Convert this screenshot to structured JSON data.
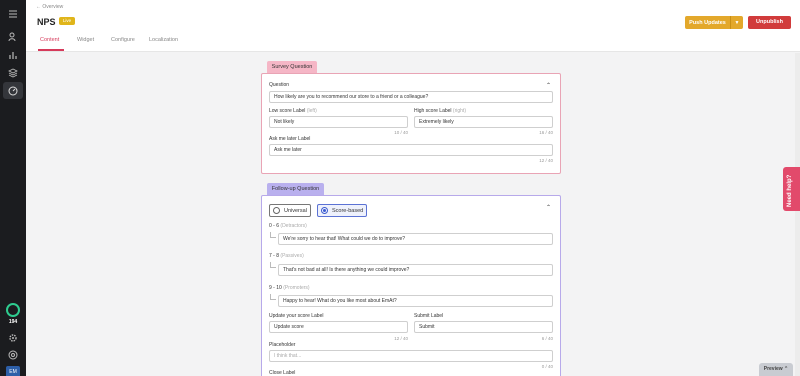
{
  "header": {
    "back_label": "Overview",
    "title": "NPS",
    "badge": "Live",
    "tabs": [
      "Content",
      "Widget",
      "Configure",
      "Localization"
    ],
    "push_label": "Push Updates",
    "unpublish_label": "Unpublish"
  },
  "sidebar": {
    "icons": [
      "users-icon",
      "bar-chart-icon",
      "layers-icon",
      "gauge-icon"
    ],
    "progress_count": "194"
  },
  "survey": {
    "tag": "Survey Question",
    "question_label": "Question",
    "question_value": "How likely are you to recommend our store to a friend or a colleague?",
    "low_label": "Low score Label",
    "low_hint": "(left)",
    "low_value": "Not likely",
    "low_counter": "10 / 40",
    "high_label": "High score Label",
    "high_hint": "(right)",
    "high_value": "Extremely likely",
    "high_counter": "16 / 40",
    "later_label": "Ask me later Label",
    "later_value": "Ask me later",
    "later_counter": "12 / 40"
  },
  "followup": {
    "tag": "Follow-up Question",
    "universal_label": "Universal",
    "score_based_label": "Score-based",
    "selected": "Score-based",
    "detractors_range": "0 - 6",
    "detractors_hint": "(Detractors)",
    "detractors_value": "We're sorry to hear that! What could we do to improve?",
    "passives_range": "7 - 8",
    "passives_hint": "(Passives)",
    "passives_value": "That's not bad at all! Is there anything we could improve?",
    "promoters_range": "9 - 10",
    "promoters_hint": "(Promoters)",
    "promoters_value": "Happy to hear! What do you like most about EmAt?",
    "update_label": "Update your score Label",
    "update_value": "Update score",
    "update_counter": "12 / 40",
    "submit_label": "Submit Label",
    "submit_value": "Submit",
    "submit_counter": "6 / 40",
    "placeholder_label": "Placeholder",
    "placeholder_value": "I think that...",
    "placeholder_counter": "0 / 40",
    "close_label": "Close Label"
  },
  "help_label": "Need help?",
  "preview_label": "Preview",
  "avatar_initials": "EM",
  "colors": {
    "accent": "#d63a5b",
    "push": "#e3a82b",
    "unpublish": "#d13b3b",
    "live": "#e0b51a"
  }
}
